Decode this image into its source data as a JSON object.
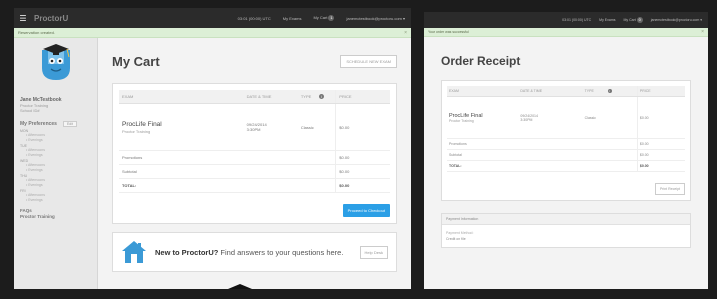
{
  "colors": {
    "page_background": "#1c1c1c",
    "topbar": "#2b2b2b",
    "alert_background": "#dcefd6",
    "primary_button": "#2b9fe6",
    "mascot": "#3b9ad6"
  },
  "cart": {
    "topbar": {
      "menu_icon": "hamburger-icon",
      "brand": "ProctorU",
      "time": "03:01 (00:00) UTC",
      "my_exams": "My Exams",
      "my_cart": "My Cart",
      "cart_count": "1",
      "account": "janemctestbook@proctoru.com ▾"
    },
    "alert": {
      "text": "Reservation created.",
      "close": "×"
    },
    "sidebar": {
      "mascot": "proctoru-mascot-logo",
      "user_name": "Jane McTestbook",
      "user_line1": "Proctor Training",
      "user_line2": "School ID#",
      "preferences_title": "My Preferences",
      "edit_label": "Edit",
      "days": [
        {
          "name": "MON",
          "slots": [
            "Afternoons",
            "Evenings"
          ]
        },
        {
          "name": "TUE",
          "slots": [
            "Afternoons",
            "Evenings"
          ]
        },
        {
          "name": "WED",
          "slots": [
            "Afternoons",
            "Evenings"
          ]
        },
        {
          "name": "THU",
          "slots": [
            "Afternoons",
            "Evenings"
          ]
        },
        {
          "name": "FRI",
          "slots": [
            "Afternoons",
            "Evenings"
          ]
        }
      ],
      "faqs_line1": "FAQs",
      "faqs_line2": "Proctor Training"
    },
    "title": "My Cart",
    "schedule_button": "SCHEDULE NEW EXAM",
    "table": {
      "headers": {
        "exam": "EXAM",
        "datetime": "DATE & TIME",
        "type": "TYPE",
        "price": "PRICE"
      },
      "item": {
        "name": "ProcLife Final",
        "sub": "Proctor Training",
        "date": "09/24/2014",
        "time": "3:30PM",
        "type": "Classic",
        "price": "$0.00"
      },
      "promotion": {
        "label": "Promotions",
        "value": "$0.00"
      },
      "subtotal": {
        "label": "Subtotal",
        "value": "$0.00"
      },
      "total": {
        "label": "TOTAL:",
        "value": "$0.00"
      }
    },
    "checkout_button": "Proceed to Checkout",
    "promo": {
      "icon": "house-icon",
      "bold": "New to ProctorU?",
      "text": " Find answers to your questions here.",
      "button": "Help Desk"
    }
  },
  "receipt": {
    "topbar": {
      "time": "03:01 (00:00) UTC",
      "my_exams": "My Exams",
      "my_cart": "My Cart",
      "cart_count": "0",
      "account": "janemctestbook@proctoru.com ▾"
    },
    "alert": {
      "text": "Your order was successful",
      "close": "×"
    },
    "title": "Order Receipt",
    "table": {
      "headers": {
        "exam": "EXAM",
        "datetime": "DATE & TIME",
        "type": "TYPE",
        "price": "PRICE"
      },
      "item": {
        "name": "ProcLife Final",
        "sub": "Proctor Training",
        "date": "09/24/2014",
        "time": "3:30PM",
        "type": "Classic",
        "price": "$0.00"
      },
      "promotion": {
        "label": "Promotions",
        "value": "$0.00"
      },
      "subtotal": {
        "label": "Subtotal",
        "value": "$0.00"
      },
      "total": {
        "label": "TOTAL:",
        "value": "$0.00"
      }
    },
    "print_button": "Print Receipt",
    "payment": {
      "header": "Payment Information",
      "method_label": "Payment Method:",
      "method_value": "Credit on file"
    }
  }
}
